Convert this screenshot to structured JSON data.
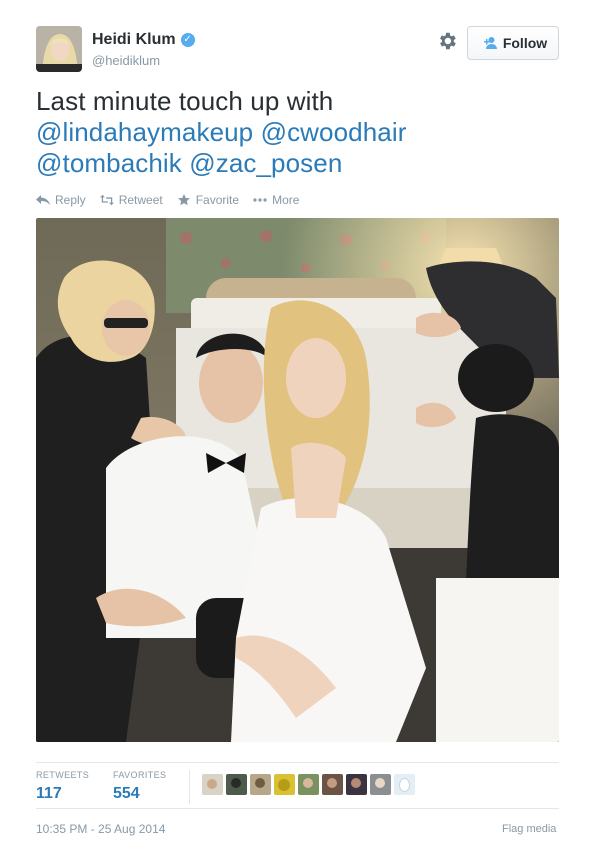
{
  "user": {
    "display_name": "Heidi Klum",
    "handle": "@heidiklum",
    "verified_icon": "verified-badge-icon"
  },
  "header": {
    "follow_label": "Follow"
  },
  "tweet": {
    "text_prefix": "Last minute touch up with",
    "mentions": [
      "@lindahaymakeup",
      "@cwoodhair",
      "@tombachik",
      "@zac_posen"
    ]
  },
  "actions": {
    "reply": "Reply",
    "retweet": "Retweet",
    "favorite": "Favorite",
    "more": "More"
  },
  "stats": {
    "retweets_label": "RETWEETS",
    "retweets_value": "117",
    "favorites_label": "FAVORITES",
    "favorites_value": "554"
  },
  "footer": {
    "timestamp": "10:35 PM - 25 Aug 2014",
    "flag_label": "Flag media"
  },
  "colors": {
    "link": "#2b7bb9",
    "verified": "#55acee",
    "muted": "#8899a6"
  }
}
